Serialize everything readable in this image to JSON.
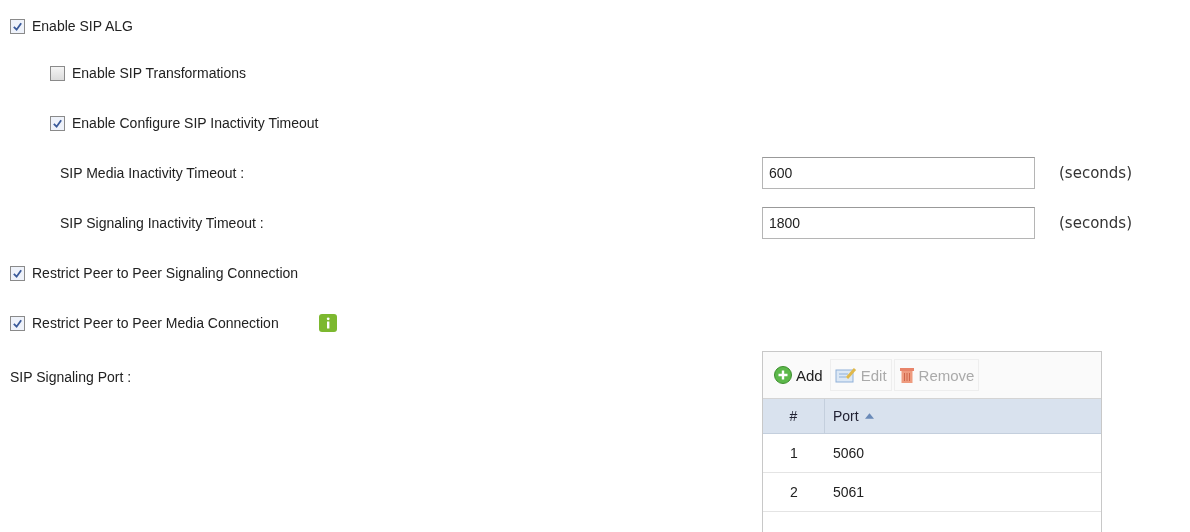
{
  "options": [
    {
      "kind": "checkbox",
      "label": "Enable SIP ALG",
      "checked": true,
      "children": [
        {
          "kind": "checkbox",
          "label": "Enable SIP Transformations",
          "checked": false
        },
        {
          "kind": "checkbox",
          "label": "Enable Configure SIP Inactivity Timeout",
          "checked": true,
          "children": [
            {
              "kind": "field",
              "label": "SIP Media Inactivity Timeout :",
              "value": "600",
              "unit": "(seconds)"
            },
            {
              "kind": "field",
              "label": "SIP Signaling Inactivity Timeout :",
              "value": "1800",
              "unit": "(seconds)"
            }
          ]
        }
      ]
    },
    {
      "kind": "checkbox",
      "label": "Restrict Peer to Peer Signaling Connection",
      "checked": true
    },
    {
      "kind": "checkbox",
      "label": "Restrict Peer to Peer Media Connection",
      "checked": true,
      "info": true
    }
  ],
  "signaling_port": {
    "label": "SIP Signaling Port :",
    "toolbar": [
      {
        "kind": "add",
        "label": "Add",
        "disabled": false
      },
      {
        "kind": "edit",
        "label": "Edit",
        "disabled": true
      },
      {
        "kind": "remove",
        "label": "Remove",
        "disabled": true
      }
    ],
    "columns": [
      {
        "label": "#",
        "sorted": false
      },
      {
        "label": "Port",
        "sorted": true
      }
    ],
    "rows": [
      [
        "1",
        "5060"
      ],
      [
        "2",
        "5061"
      ]
    ]
  }
}
